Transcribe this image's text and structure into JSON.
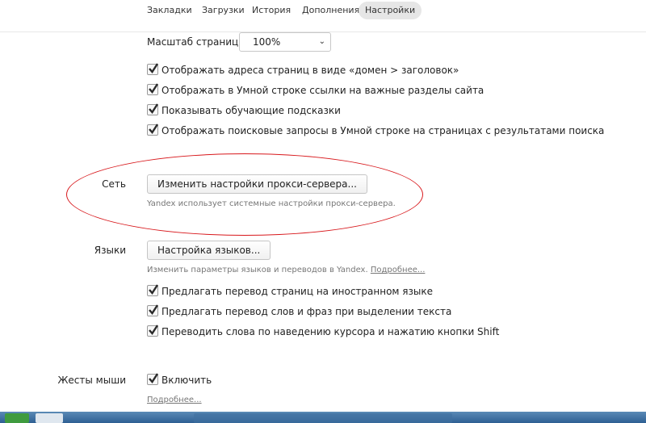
{
  "topnav": {
    "tabs": [
      {
        "label": "Закладки",
        "active": false
      },
      {
        "label": "Загрузки",
        "active": false
      },
      {
        "label": "История",
        "active": false
      },
      {
        "label": "Дополнения",
        "active": false
      },
      {
        "label": "Настройки",
        "active": true
      }
    ]
  },
  "zoom": {
    "label": "Масштаб страницы:",
    "value": "100%"
  },
  "general_options": [
    {
      "label": "Отображать адреса страниц в виде «домен > заголовок»",
      "checked": true
    },
    {
      "label": "Отображать в Умной строке ссылки на важные разделы сайта",
      "checked": true
    },
    {
      "label": "Показывать обучающие подсказки",
      "checked": true
    },
    {
      "label": "Отображать поисковые запросы в Умной строке на страницах с результатами поиска",
      "checked": true
    }
  ],
  "network": {
    "section_label": "Сеть",
    "button_label": "Изменить настройки прокси-сервера...",
    "hint": "Yandex использует системные настройки прокси-сервера.",
    "annotation_color": "#d8181c"
  },
  "languages": {
    "section_label": "Языки",
    "button_label": "Настройка языков...",
    "hint": "Изменить параметры языков и переводов в Yandex.",
    "more_link": "Подробнее...",
    "options": [
      {
        "label": "Предлагать перевод страниц на иностранном языке",
        "checked": true
      },
      {
        "label": "Предлагать перевод слов и фраз при выделении текста",
        "checked": true
      },
      {
        "label": "Переводить слова по наведению курсора и нажатию кнопки Shift",
        "checked": true
      }
    ]
  },
  "mouse_gestures": {
    "section_label": "Жесты мыши",
    "enable_label": "Включить",
    "checked": true,
    "more_link": "Подробнее..."
  },
  "colors": {
    "accent_check": "#3a3a3a",
    "taskbar": "#2e5f93"
  }
}
